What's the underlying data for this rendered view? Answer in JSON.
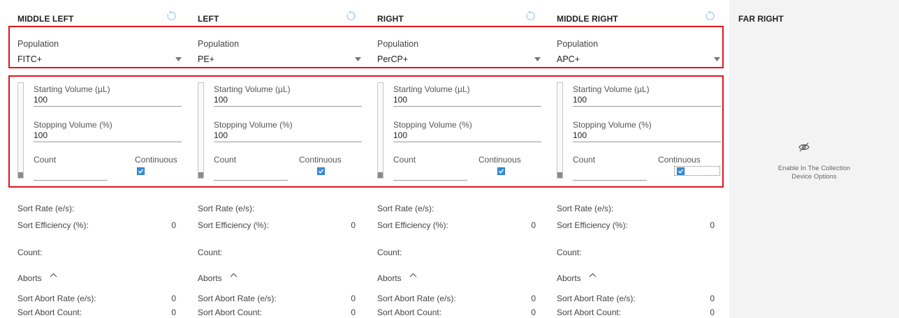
{
  "columns": [
    {
      "title": "MIDDLE LEFT",
      "population_label": "Population",
      "population_value": "FITC+",
      "starting_volume_label": "Starting Volume (µL)",
      "starting_volume_value": "100",
      "stopping_volume_label": "Stopping Volume (%)",
      "stopping_volume_value": "100",
      "count_label": "Count",
      "count_value": "",
      "continuous_label": "Continuous",
      "continuous_checked": true,
      "volume_level_fraction": 0.06,
      "sort_rate_label": "Sort Rate (e/s):",
      "sort_rate_value": "",
      "sort_efficiency_label": "Sort Efficiency (%):",
      "sort_efficiency_value": "0",
      "count_stat_label": "Count:",
      "count_stat_value": "",
      "aborts_label": "Aborts",
      "sort_abort_rate_label": "Sort Abort Rate (e/s):",
      "sort_abort_rate_value": "0",
      "sort_abort_count_label": "Sort Abort Count:",
      "sort_abort_count_value": "0"
    },
    {
      "title": "LEFT",
      "population_label": "Population",
      "population_value": "PE+",
      "starting_volume_label": "Starting Volume (µL)",
      "starting_volume_value": "100",
      "stopping_volume_label": "Stopping Volume (%)",
      "stopping_volume_value": "100",
      "count_label": "Count",
      "count_value": "",
      "continuous_label": "Continuous",
      "continuous_checked": true,
      "volume_level_fraction": 0.06,
      "sort_rate_label": "Sort Rate (e/s):",
      "sort_rate_value": "",
      "sort_efficiency_label": "Sort Efficiency (%):",
      "sort_efficiency_value": "0",
      "count_stat_label": "Count:",
      "count_stat_value": "",
      "aborts_label": "Aborts",
      "sort_abort_rate_label": "Sort Abort Rate (e/s):",
      "sort_abort_rate_value": "0",
      "sort_abort_count_label": "Sort Abort Count:",
      "sort_abort_count_value": "0"
    },
    {
      "title": "RIGHT",
      "population_label": "Population",
      "population_value": "PerCP+",
      "starting_volume_label": "Starting Volume (µL)",
      "starting_volume_value": "100",
      "stopping_volume_label": "Stopping Volume (%)",
      "stopping_volume_value": "100",
      "count_label": "Count",
      "count_value": "",
      "continuous_label": "Continuous",
      "continuous_checked": true,
      "volume_level_fraction": 0.06,
      "sort_rate_label": "Sort Rate (e/s):",
      "sort_rate_value": "",
      "sort_efficiency_label": "Sort Efficiency (%):",
      "sort_efficiency_value": "0",
      "count_stat_label": "Count:",
      "count_stat_value": "",
      "aborts_label": "Aborts",
      "sort_abort_rate_label": "Sort Abort Rate (e/s):",
      "sort_abort_rate_value": "0",
      "sort_abort_count_label": "Sort Abort Count:",
      "sort_abort_count_value": "0"
    },
    {
      "title": "MIDDLE RIGHT",
      "population_label": "Population",
      "population_value": "APC+",
      "starting_volume_label": "Starting Volume (µL)",
      "starting_volume_value": "100",
      "stopping_volume_label": "Stopping Volume (%)",
      "stopping_volume_value": "100",
      "count_label": "Count",
      "count_value": "",
      "continuous_label": "Continuous",
      "continuous_checked": true,
      "volume_level_fraction": 0.06,
      "sort_rate_label": "Sort Rate (e/s):",
      "sort_rate_value": "",
      "sort_efficiency_label": "Sort Efficiency (%):",
      "sort_efficiency_value": "0",
      "count_stat_label": "Count:",
      "count_stat_value": "",
      "aborts_label": "Aborts",
      "sort_abort_rate_label": "Sort Abort Rate (e/s):",
      "sort_abort_rate_value": "0",
      "sort_abort_count_label": "Sort Abort Count:",
      "sort_abort_count_value": "0"
    }
  ],
  "far_right": {
    "title": "FAR RIGHT",
    "message_line1": "Enable In The Collection",
    "message_line2": "Device Options",
    "icon": "eye-off-icon"
  },
  "colors": {
    "highlight_border": "#e0161b",
    "checkbox": "#3a8fd8",
    "reset_icon": "#b8d4ee",
    "disabled_panel": "#f3f3f3"
  }
}
